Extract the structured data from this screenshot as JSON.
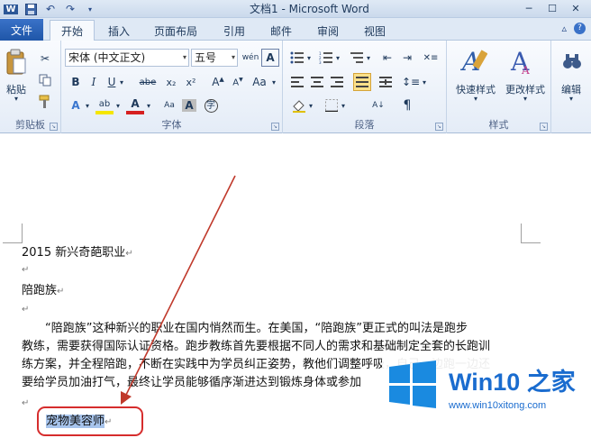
{
  "window": {
    "title": "文档1 - Microsoft Word"
  },
  "tabs": [
    {
      "label": "文件"
    },
    {
      "label": "开始"
    },
    {
      "label": "插入"
    },
    {
      "label": "页面布局"
    },
    {
      "label": "引用"
    },
    {
      "label": "邮件"
    },
    {
      "label": "审阅"
    },
    {
      "label": "视图"
    }
  ],
  "ribbon": {
    "clipboard": {
      "label": "剪贴板",
      "paste": "粘贴"
    },
    "font": {
      "label": "字体",
      "name": "宋体 (中文正文)",
      "size": "五号",
      "bold": "B",
      "italic": "I",
      "underline": "U",
      "strike": "abe",
      "sub": "x₂",
      "sup": "x²",
      "wen": "wén",
      "A_box": "A"
    },
    "paragraph": {
      "label": "段落"
    },
    "styles": {
      "label": "样式",
      "quick": "快速样式",
      "change": "更改样式"
    },
    "editing": {
      "label": "编辑"
    }
  },
  "document": {
    "lines": [
      "2015 新兴奇葩职业",
      "",
      "陪跑族",
      "",
      "　　“陪跑族”这种新兴的职业在国内悄然而生。在美国，“陪跑族”更正式的叫法是跑步",
      "教练，需要获得国际认证资格。跑步教练首先要根据不同人的需求和基础制定全套的长跑训",
      "练方案，并全程陪跑，不断在实践中为学员纠正姿势，教他们调整呼吸，自己一边跑一边还",
      "要给学员加油打气，最终让学员能够循序渐进达到锻炼身体或参加",
      ""
    ],
    "selected": "宠物美容师",
    "para_mark": "↵"
  },
  "watermark": {
    "brand": "Win10 之家",
    "url": "www.win10xitong.com"
  },
  "colors": {
    "accent": "#1f56a8",
    "highlight_box": "#d62d2d",
    "arrow": "#c0392b",
    "selection": "#a7c4ec"
  }
}
